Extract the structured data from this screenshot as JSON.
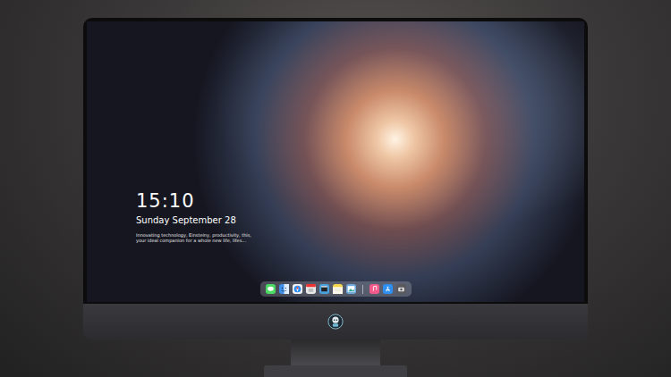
{
  "lock_screen": {
    "time": "15:10",
    "date": "Sunday September 28",
    "tagline": [
      "Innovating technology, Einsteiny, productivity, this,",
      "your ideal companion for a whole new life, lifes..."
    ]
  },
  "dock": {
    "apps": [
      {
        "kind": "messages",
        "color": "#4cd964"
      },
      {
        "kind": "finder",
        "color": "#3d8fe8"
      },
      {
        "kind": "safari",
        "color": "#f2f2f2"
      },
      {
        "kind": "calendar",
        "color": "#e8e8e8"
      },
      {
        "kind": "video",
        "color": "#4aa3df"
      },
      {
        "kind": "notes",
        "color": "#f7d54a"
      },
      {
        "kind": "photos",
        "color": "#6fa8dc"
      }
    ],
    "extras": [
      {
        "kind": "music",
        "color": "#f25a8a"
      },
      {
        "kind": "appstore",
        "color": "#2f8ff0"
      },
      {
        "kind": "camera",
        "color": "#5a5a5e"
      }
    ]
  }
}
